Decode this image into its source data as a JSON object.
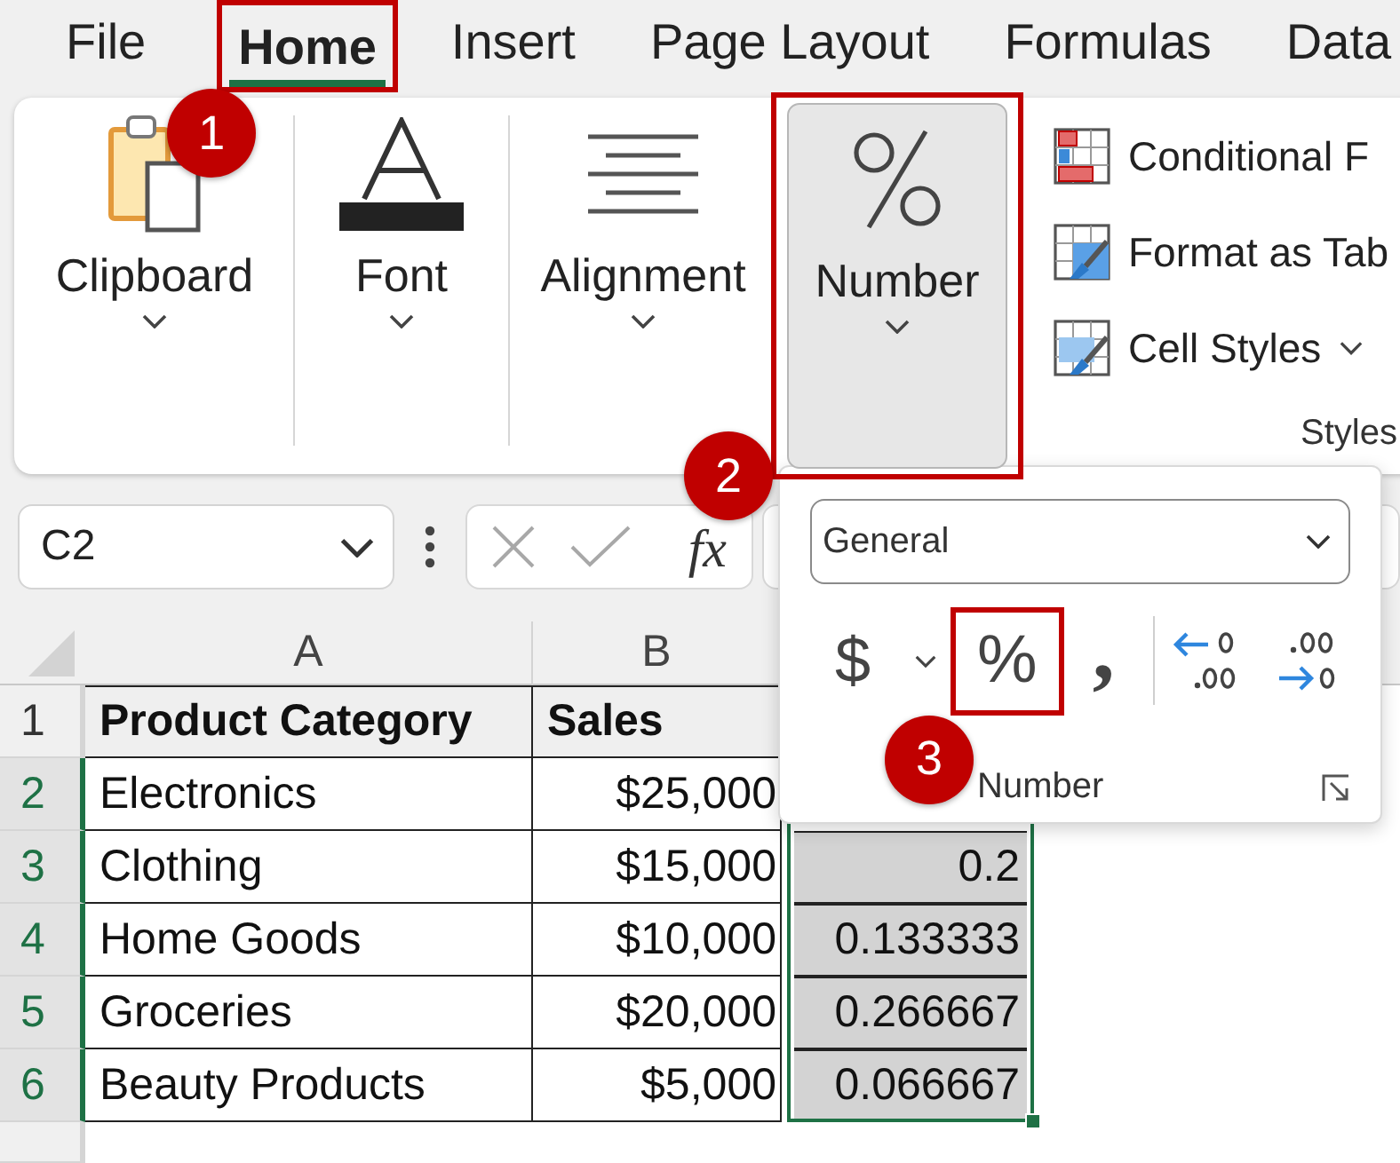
{
  "ribbon_tabs": [
    {
      "label": "File",
      "selected": false,
      "highlighted": false
    },
    {
      "label": "Home",
      "selected": true,
      "highlighted": true,
      "callout": "1"
    },
    {
      "label": "Insert",
      "selected": false,
      "highlighted": false
    },
    {
      "label": "Page Layout",
      "selected": false,
      "highlighted": false
    },
    {
      "label": "Formulas",
      "selected": false,
      "highlighted": false
    },
    {
      "label": "Data",
      "selected": false,
      "highlighted": false
    }
  ],
  "ribbon": {
    "groups": [
      {
        "kind": "clipboard",
        "label": "Clipboard",
        "expanded": false,
        "highlighted": false
      },
      {
        "kind": "font",
        "label": "Font",
        "expanded": false,
        "highlighted": false
      },
      {
        "kind": "alignment",
        "label": "Alignment",
        "expanded": false,
        "highlighted": false
      },
      {
        "kind": "number",
        "label": "Number",
        "expanded": true,
        "highlighted": true,
        "callout": "2"
      }
    ],
    "styles": {
      "label": "Styles",
      "items": [
        {
          "kind": "conditional-formatting",
          "label": "Conditional F",
          "dropdown": false
        },
        {
          "kind": "format-as-table",
          "label": "Format as Tab",
          "dropdown": false
        },
        {
          "kind": "cell-styles",
          "label": "Cell Styles",
          "dropdown": true
        }
      ]
    }
  },
  "formula_bar": {
    "name_box": "C2",
    "function_button": "fx"
  },
  "sheet": {
    "columns": [
      "A",
      "B"
    ],
    "rows": [
      {
        "header": "1",
        "kind": "header",
        "selected": false,
        "cells": [
          {
            "text": "Product Category"
          },
          {
            "text": "Sales"
          }
        ]
      },
      {
        "header": "2",
        "kind": "data",
        "selected": true,
        "cells": [
          {
            "text": "Electronics"
          },
          {
            "text": "$25,000"
          }
        ]
      },
      {
        "header": "3",
        "kind": "data",
        "selected": true,
        "cells": [
          {
            "text": "Clothing"
          },
          {
            "text": "$15,000"
          },
          {
            "text": "0.2",
            "selected": true
          }
        ]
      },
      {
        "header": "4",
        "kind": "data",
        "selected": true,
        "cells": [
          {
            "text": "Home Goods"
          },
          {
            "text": "$10,000"
          },
          {
            "text": "0.133333",
            "selected": true
          }
        ]
      },
      {
        "header": "5",
        "kind": "data",
        "selected": true,
        "cells": [
          {
            "text": "Groceries"
          },
          {
            "text": "$20,000"
          },
          {
            "text": "0.266667",
            "selected": true
          }
        ]
      },
      {
        "header": "6",
        "kind": "data",
        "selected": true,
        "cells": [
          {
            "text": "Beauty Products"
          },
          {
            "text": "$5,000"
          },
          {
            "text": "0.066667",
            "selected": true
          }
        ]
      }
    ]
  },
  "number_panel": {
    "format": "General",
    "buttons": [
      {
        "kind": "currency",
        "label": "$",
        "dropdown": true,
        "highlighted": false
      },
      {
        "kind": "percent",
        "label": "%",
        "highlighted": true,
        "callout": "3"
      },
      {
        "kind": "comma",
        "label": ",",
        "highlighted": false
      },
      {
        "kind": "increase-decimal",
        "highlighted": false
      },
      {
        "kind": "decrease-decimal",
        "highlighted": false
      }
    ],
    "label": "Number"
  }
}
